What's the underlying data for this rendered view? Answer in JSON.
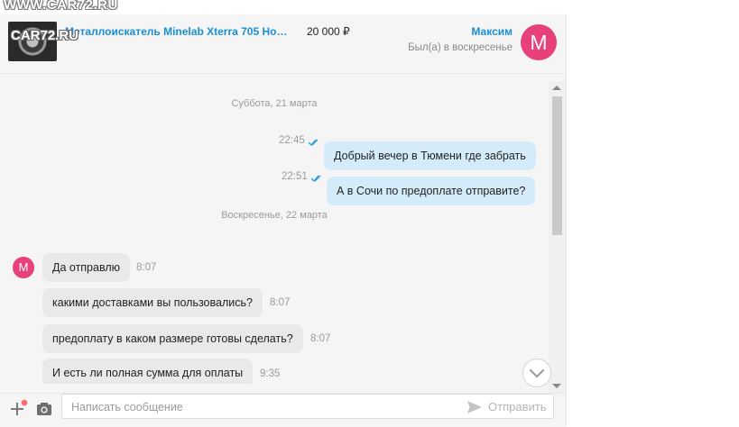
{
  "watermark": "WWW.CAR72.RU",
  "header": {
    "product_title": "Металлоискатель Minelab Xterra 705 Нов…",
    "product_thumb_watermark": "CAR72.RU",
    "price": "20 000 ₽",
    "user_name": "Максим",
    "user_status": "Был(а) в воскресенье",
    "avatar_letter": "M",
    "avatar_color": "#e8407a"
  },
  "messages": {
    "day_1": "Суббота, 21 марта",
    "day_2": "Воскресенье, 22 марта",
    "outgoing": [
      {
        "text": "Добрый вечер в Тюмени где забрать",
        "time": "22:45"
      },
      {
        "text": "А в Сочи по предоплате отправите?",
        "time": "22:51"
      }
    ],
    "incoming_avatar_letter": "M",
    "incoming": [
      {
        "text": "Да отправлю",
        "time": "8:07"
      },
      {
        "text": "какими доставками вы пользовались?",
        "time": "8:07"
      },
      {
        "text": "предоплату в каком размере готовы сделать?",
        "time": "8:07"
      },
      {
        "text": "И есть ли полная сумма для оплаты",
        "time": "9:35"
      }
    ]
  },
  "composer": {
    "placeholder": "Написать сообщение",
    "send_label": "Отправить"
  },
  "icons": {
    "attach": "plus-icon",
    "camera": "camera-icon",
    "send": "send-icon",
    "read_ticks": "double-check-icon",
    "scroll_down": "chevron-down-icon"
  },
  "colors": {
    "accent": "#1a8fd6",
    "outgoing_bubble": "#d4ecfa",
    "incoming_bubble": "#e9e9e9",
    "avatar": "#e8407a"
  }
}
